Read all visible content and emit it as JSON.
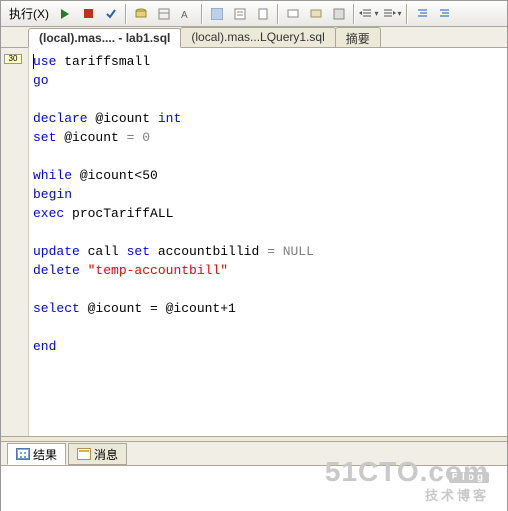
{
  "toolbar": {
    "execute_label": "执行(X)"
  },
  "tabs": {
    "active": "(local).mas.... - lab1.sql",
    "second": "(local).mas...LQuery1.sql",
    "summary": "摘要"
  },
  "gutter": {
    "marker": "30"
  },
  "code": {
    "l1_kw": "use",
    "l1_id": "tariffsmall",
    "l2_kw": "go",
    "l3_kw": "declare",
    "l3_var": "@icount",
    "l3_ty": "int",
    "l4_kw": "set",
    "l4_var": "@icount",
    "l4_rest": " = 0",
    "l5_kw": "while",
    "l5_rest": " @icount<50",
    "l6_kw": "begin",
    "l7_kw": "exec",
    "l7_id": " procTariffALL",
    "l8_kw": "update",
    "l8_a": " call ",
    "l8_kw2": "set",
    "l8_b": " accountbillid ",
    "l8_op": "=",
    "l8_sp": " ",
    "l8_null": "NULL",
    "l9_kw": "delete",
    "l9_sp": " ",
    "l9_str": "\"temp-accountbill\"",
    "l10_kw": "select",
    "l10_rest": " @icount = @icount+1",
    "l11_kw": "end"
  },
  "results": {
    "tab1": "结果",
    "tab2": "消息"
  },
  "watermark": {
    "main": "51CTO.com",
    "sub": "技术博客",
    "blog": "Blog"
  }
}
